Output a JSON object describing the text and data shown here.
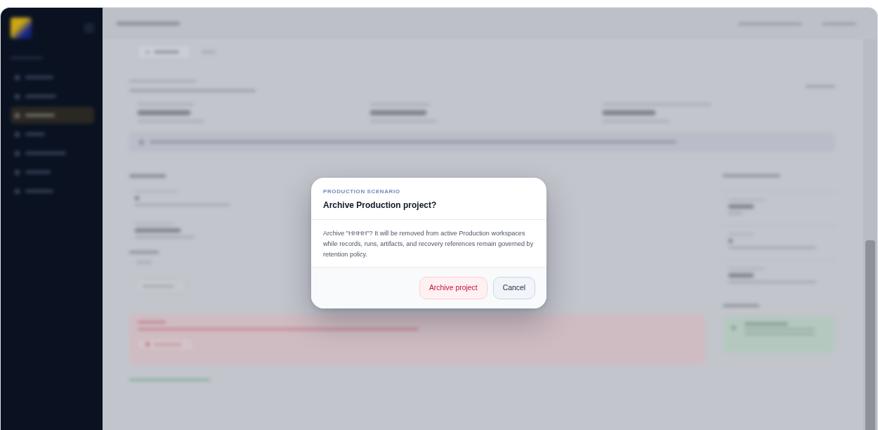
{
  "dialog": {
    "eyebrow": "PRODUCTION SCENARIO",
    "title": "Archive Production project?",
    "message": "Archive \"HHHH\"? It will be removed from active Production workspaces while records, runs, artifacts, and recovery references remain governed by retention policy.",
    "buttons": [
      {
        "label": "Archive project",
        "kind": "danger"
      },
      {
        "label": "Cancel",
        "kind": "secondary"
      }
    ]
  }
}
